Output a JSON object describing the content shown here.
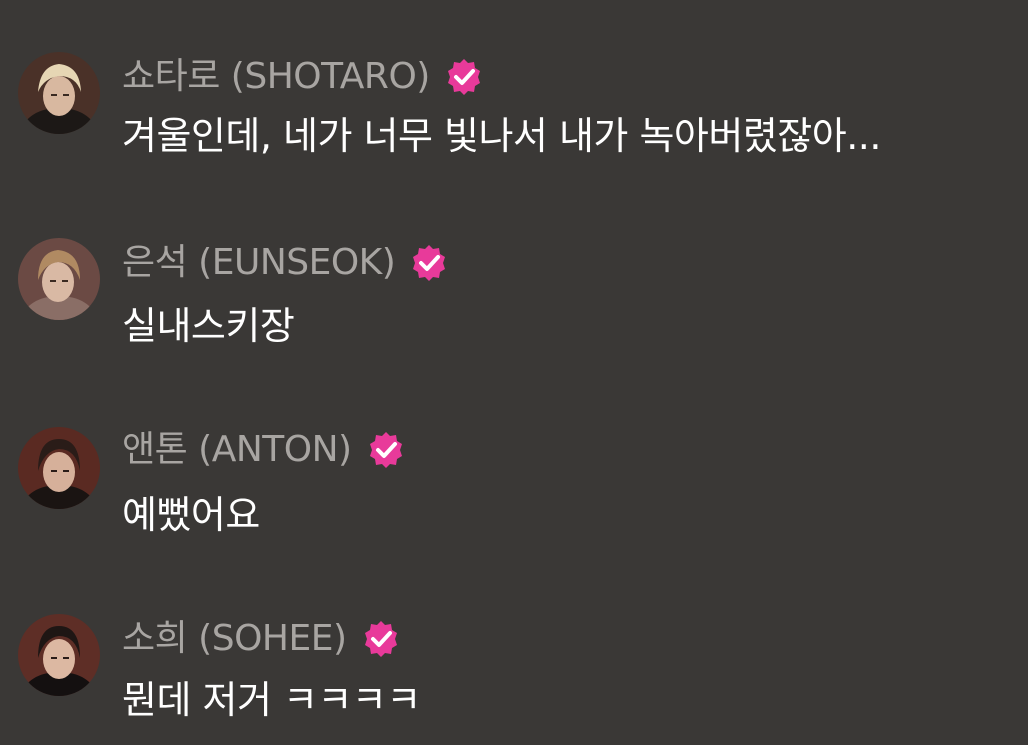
{
  "badge_color": "#e83a9a",
  "messages": [
    {
      "author": "쇼타로 (SHOTARO)",
      "text": "겨울인데, 네가 너무 빛나서 내가 녹아버렸잖아...",
      "avatar_icon": "user-avatar",
      "badge_icon": "verified-badge-icon"
    },
    {
      "author": "은석 (EUNSEOK)",
      "text": "실내스키장",
      "avatar_icon": "user-avatar",
      "badge_icon": "verified-badge-icon"
    },
    {
      "author": "앤톤 (ANTON)",
      "text": "예뻤어요",
      "avatar_icon": "user-avatar",
      "badge_icon": "verified-badge-icon"
    },
    {
      "author": "소희 (SOHEE)",
      "text": "뭔데 저거 ㅋㅋㅋㅋ",
      "avatar_icon": "user-avatar",
      "badge_icon": "verified-badge-icon"
    }
  ]
}
